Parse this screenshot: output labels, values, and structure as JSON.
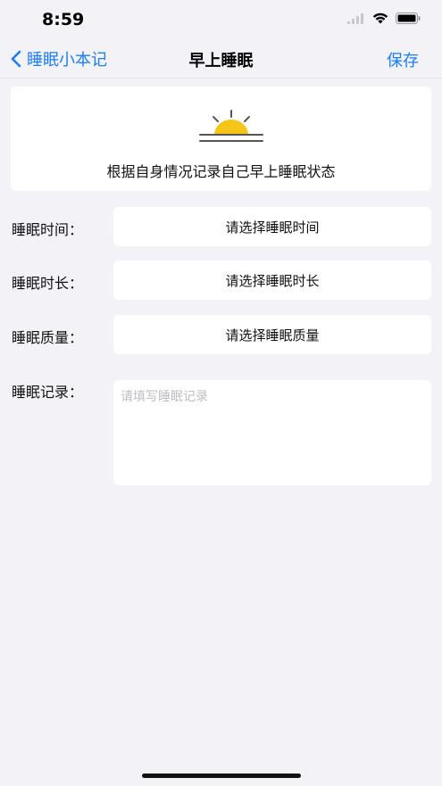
{
  "status_bar": {
    "time": "8:59"
  },
  "nav": {
    "back_label": "睡眠小本记",
    "title": "早上睡眠",
    "save_label": "保存"
  },
  "intro": {
    "icon": "sunrise-icon",
    "text": "根据自身情况记录自己早上睡眠状态"
  },
  "form": {
    "time_label": "睡眠时间：",
    "time_placeholder": "请选择睡眠时间",
    "duration_label": "睡眠时长：",
    "duration_placeholder": "请选择睡眠时长",
    "quality_label": "睡眠质量：",
    "quality_placeholder": "请选择睡眠质量",
    "record_label": "睡眠记录：",
    "record_placeholder": "请填写睡眠记录"
  },
  "colors": {
    "accent": "#1a7ef5",
    "background": "#f2f2f7",
    "sun": "#f5c518"
  }
}
